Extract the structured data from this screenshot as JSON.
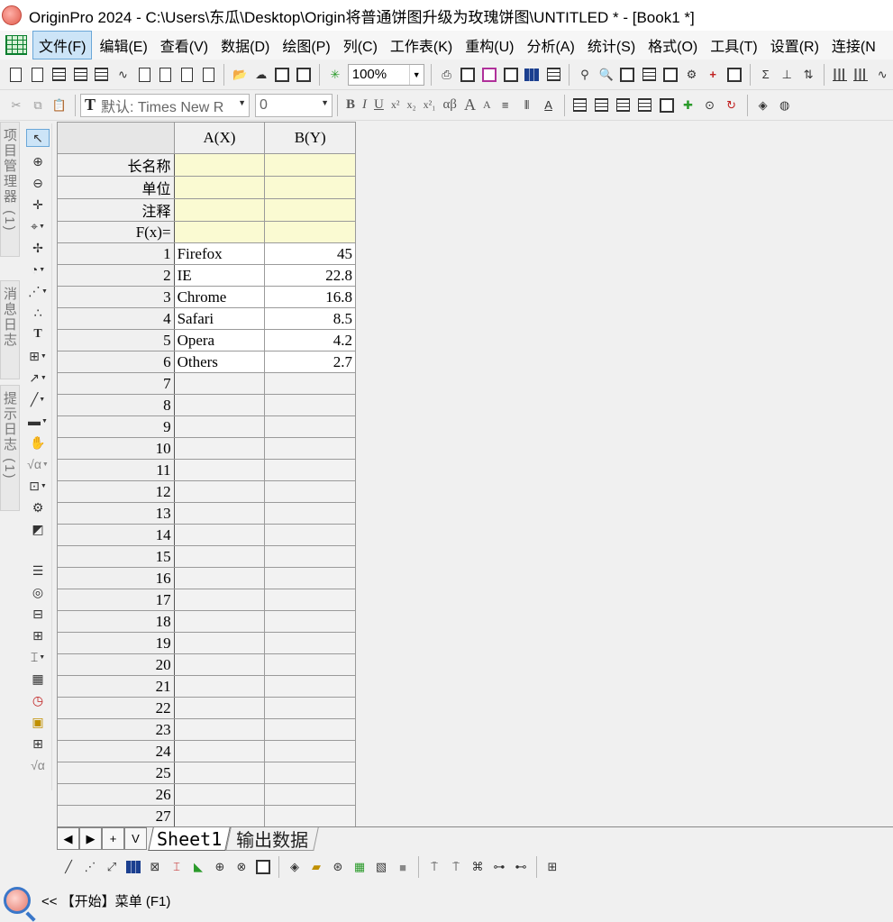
{
  "window": {
    "title": "OriginPro 2024 - C:\\Users\\东瓜\\Desktop\\Origin将普通饼图升级为玫瑰饼图\\UNTITLED * - [Book1 *]"
  },
  "menu": {
    "items": [
      "文件(F)",
      "编辑(E)",
      "查看(V)",
      "数据(D)",
      "绘图(P)",
      "列(C)",
      "工作表(K)",
      "重构(U)",
      "分析(A)",
      "统计(S)",
      "格式(O)",
      "工具(T)",
      "设置(R)",
      "连接(N"
    ]
  },
  "toolbar": {
    "zoom": "100%",
    "font_name": "默认: Times New R",
    "font_size": "0",
    "format_buttons": [
      "B",
      "I",
      "U",
      "x²",
      "x₂",
      "x²₁",
      "αβ",
      "A",
      "A"
    ]
  },
  "side_tabs": [
    "项目管理器 (1)",
    "消息日志",
    "提示日志 (1)"
  ],
  "worksheet": {
    "columns": [
      "A(X)",
      "B(Y)"
    ],
    "meta_rows": [
      "长名称",
      "单位",
      "注释",
      "F(x)="
    ],
    "rows": [
      {
        "n": "1",
        "a": "Firefox",
        "b": "45"
      },
      {
        "n": "2",
        "a": "IE",
        "b": "22.8"
      },
      {
        "n": "3",
        "a": "Chrome",
        "b": "16.8"
      },
      {
        "n": "4",
        "a": "Safari",
        "b": "8.5"
      },
      {
        "n": "5",
        "a": "Opera",
        "b": "4.2"
      },
      {
        "n": "6",
        "a": "Others",
        "b": "2.7"
      },
      {
        "n": "7",
        "a": "",
        "b": ""
      },
      {
        "n": "8",
        "a": "",
        "b": ""
      },
      {
        "n": "9",
        "a": "",
        "b": ""
      },
      {
        "n": "10",
        "a": "",
        "b": ""
      },
      {
        "n": "11",
        "a": "",
        "b": ""
      },
      {
        "n": "12",
        "a": "",
        "b": ""
      },
      {
        "n": "13",
        "a": "",
        "b": ""
      },
      {
        "n": "14",
        "a": "",
        "b": ""
      },
      {
        "n": "15",
        "a": "",
        "b": ""
      },
      {
        "n": "16",
        "a": "",
        "b": ""
      },
      {
        "n": "17",
        "a": "",
        "b": ""
      },
      {
        "n": "18",
        "a": "",
        "b": ""
      },
      {
        "n": "19",
        "a": "",
        "b": ""
      },
      {
        "n": "20",
        "a": "",
        "b": ""
      },
      {
        "n": "21",
        "a": "",
        "b": ""
      },
      {
        "n": "22",
        "a": "",
        "b": ""
      },
      {
        "n": "23",
        "a": "",
        "b": ""
      },
      {
        "n": "24",
        "a": "",
        "b": ""
      },
      {
        "n": "25",
        "a": "",
        "b": ""
      },
      {
        "n": "26",
        "a": "",
        "b": ""
      },
      {
        "n": "27",
        "a": "",
        "b": ""
      }
    ]
  },
  "sheet_tabs": {
    "nav": [
      "◀",
      "▶",
      "+",
      "V"
    ],
    "tabs": [
      "Sheet1",
      "输出数据"
    ]
  },
  "status": {
    "text": "<< 【开始】菜单 (F1)"
  }
}
